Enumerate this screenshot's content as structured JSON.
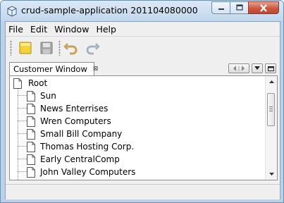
{
  "window": {
    "title": "crud-sample-application 201104080000",
    "icon": "app-cube-icon",
    "buttons": [
      "minimize-icon",
      "maximize-icon",
      "close-icon"
    ]
  },
  "menubar": {
    "items": [
      {
        "label": "File"
      },
      {
        "label": "Edit"
      },
      {
        "label": "Window"
      },
      {
        "label": "Help"
      }
    ]
  },
  "toolbar": {
    "items": [
      "new-file-icon",
      "save-icon",
      "undo-icon",
      "redo-icon"
    ]
  },
  "panel": {
    "tab_label": "Customer Window",
    "tab_close": "⊠",
    "tree": {
      "root_label": "Root",
      "items": [
        {
          "label": "Sun"
        },
        {
          "label": "News Enterrises"
        },
        {
          "label": "Wren Computers"
        },
        {
          "label": "Small Bill Company"
        },
        {
          "label": "Thomas Hosting Corp."
        },
        {
          "label": "Early CentralComp"
        },
        {
          "label": "John Valley Computers"
        }
      ]
    }
  },
  "colors": {
    "titlebar": "#c7ddf2",
    "close_button": "#c75a43",
    "client_background": "#f0f0f0",
    "new_file_icon": "#f4d23a"
  }
}
